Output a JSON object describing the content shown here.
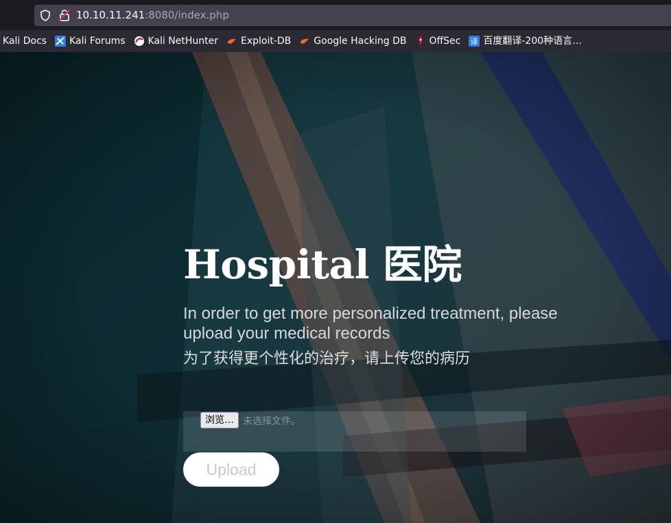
{
  "browser": {
    "url_host": "10.10.11.241",
    "url_rest": ":8080/index.php",
    "bookmarks": [
      {
        "label": "Kali Docs",
        "icon": "kali-docs-icon"
      },
      {
        "label": "Kali Forums",
        "icon": "kali-forums-icon"
      },
      {
        "label": "Kali NetHunter",
        "icon": "kali-nethunter-icon"
      },
      {
        "label": "Exploit-DB",
        "icon": "exploit-db-icon"
      },
      {
        "label": "Google Hacking DB",
        "icon": "google-hacking-db-icon"
      },
      {
        "label": "OffSec",
        "icon": "offsec-icon"
      },
      {
        "label": "百度翻译-200种语言…",
        "icon": "baidu-translate-icon"
      }
    ]
  },
  "page": {
    "title": "Hospital  医院",
    "subtitle": "In order to get more personalized treatment, please upload your medical records",
    "subtitle_cn": "为了获得更个性化的治疗，请上传您的病历",
    "browse_label": "浏览…",
    "file_status": "未选择文件。",
    "upload_label": "Upload"
  },
  "colors": {
    "page_bg": "#163a42",
    "chrome_bg": "#1c1b22",
    "bookmarks_bg": "#2b2a33",
    "upload_button": "#ffffff"
  }
}
